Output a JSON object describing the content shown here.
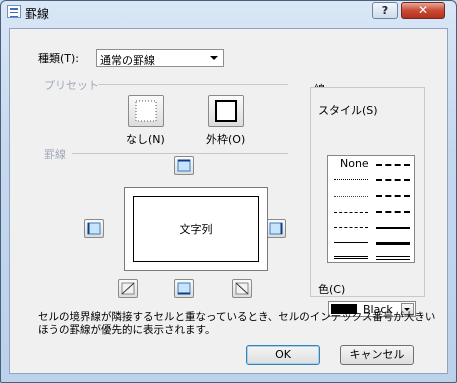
{
  "window": {
    "title": "罫線",
    "help_label": "?",
    "close_label": "✕"
  },
  "kind": {
    "label": "種類(T):",
    "value": "通常の罫線"
  },
  "presets": {
    "group_label": "プリセット",
    "none_label": "なし(N)",
    "outline_label": "外枠(O)"
  },
  "border": {
    "group_label": "罫線",
    "preview_text": "文字列"
  },
  "line": {
    "group_label": "線",
    "style_label": "スタイル(S)",
    "none_label": "None",
    "color_label": "色(C)",
    "color_value": "Black",
    "color_swatch": "#000000"
  },
  "description": "セルの境界線が隣接するセルと重なっているとき、セルのインデックス番号が大きいほうの罫線が優先的に表示されます。",
  "buttons": {
    "ok": "OK",
    "cancel": "キャンセル"
  },
  "colors": {
    "accent": "#3c7fb1",
    "group_text": "#a0a8b8"
  }
}
